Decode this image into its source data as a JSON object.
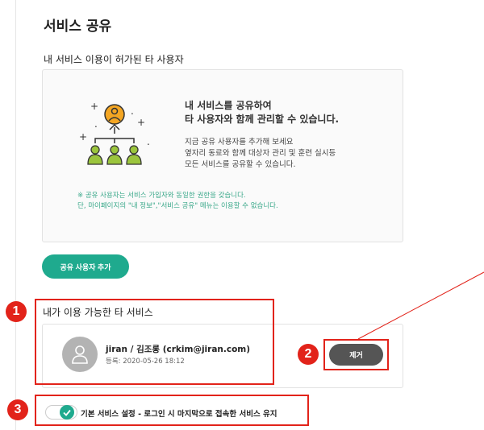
{
  "page": {
    "title": "서비스 공유",
    "permitted_users_heading": "내 서비스 이용이 허가된 타 사용자"
  },
  "info": {
    "heading_line1": "내 서비스를 공유하여",
    "heading_line2": "타 사용자와 함께 관리할 수 있습니다.",
    "body_line1": "지금 공유 사용자를 추가해 보세요",
    "body_line2": "옆자리 동료와 함께 대상자 관리 및 훈련 실시등",
    "body_line3": "모든 서비스를 공유할 수 있습니다.",
    "note_line1": "※ 공유 사용자는 서비스 가입자와 동일한 권한을 갖습니다.",
    "note_line2": "단, 마이페이지의 \"내 정보\",\"서비스 공유\" 메뉴는 이용할 수 없습니다."
  },
  "buttons": {
    "add_shared_user": "공유 사용자 추가",
    "remove": "제거"
  },
  "available_services": {
    "heading": "내가 이용 가능한 타 서비스",
    "items": [
      {
        "name": "jiran / 김조롱 (crkim@jiran.com)",
        "registered": "등록: 2020-05-26 18:12"
      }
    ]
  },
  "default_setting": {
    "label": "기본 서비스 설정 - 로그인 시 마지막으로 접속한 서비스 유지",
    "enabled": true
  },
  "annotations": [
    "1",
    "2",
    "3"
  ],
  "colors": {
    "accent": "#1faa8e",
    "annotation": "#e2231a",
    "remove_button": "#555555"
  }
}
